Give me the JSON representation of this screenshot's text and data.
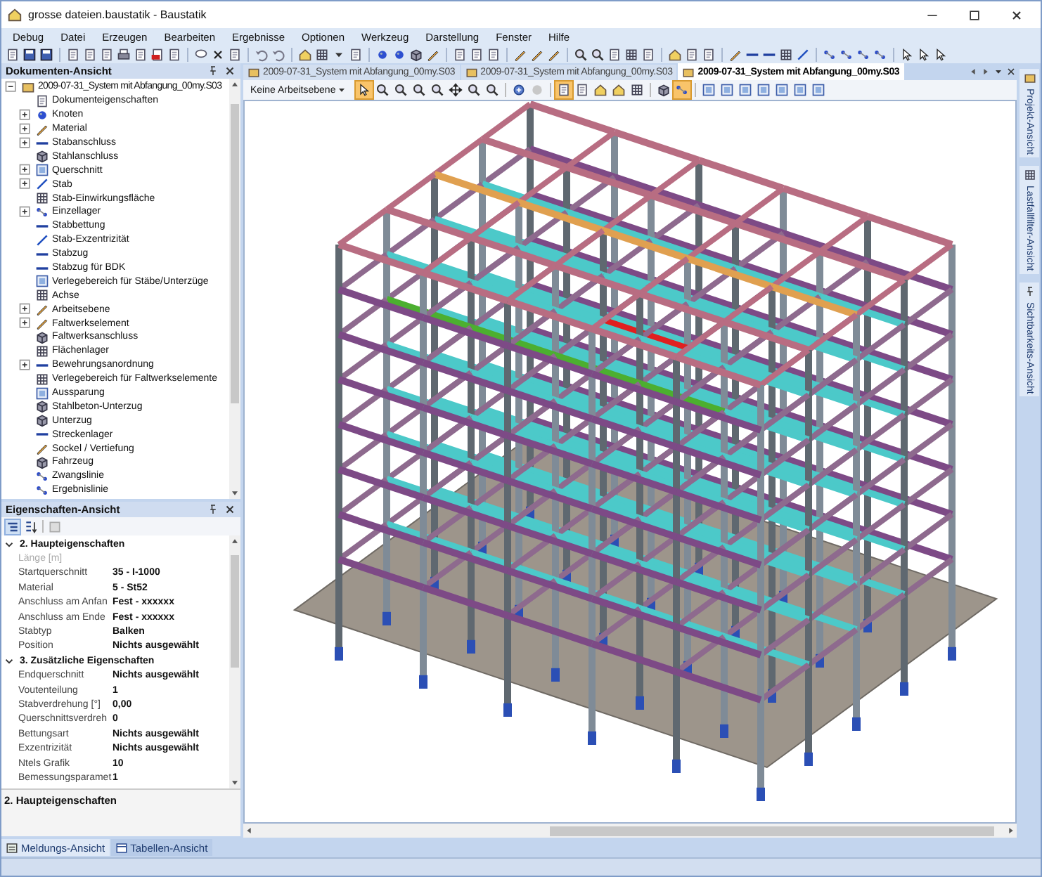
{
  "window": {
    "title": "grosse dateien.baustatik - Baustatik"
  },
  "menu": [
    "Debug",
    "Datei",
    "Erzeugen",
    "Bearbeiten",
    "Ergebnisse",
    "Optionen",
    "Werkzeug",
    "Darstellung",
    "Fenster",
    "Hilfe"
  ],
  "documents_panel": {
    "title": "Dokumenten-Ansicht",
    "tree": [
      {
        "label": "2009-07-31_System mit Abfangung_00my.S03",
        "kind": "folder",
        "expanded": true,
        "children": [
          {
            "label": "Dokumenteigenschaften",
            "kind": "leaf"
          },
          {
            "label": "Knoten",
            "kind": "folder",
            "expanded": false
          },
          {
            "label": "Material",
            "kind": "folder",
            "expanded": false
          },
          {
            "label": "Stabanschluss",
            "kind": "folder",
            "expanded": false
          },
          {
            "label": "Stahlanschluss",
            "kind": "leaf"
          },
          {
            "label": "Querschnitt",
            "kind": "folder",
            "expanded": false
          },
          {
            "label": "Stab",
            "kind": "folder",
            "expanded": false
          },
          {
            "label": "Stab-Einwirkungsfläche",
            "kind": "leaf"
          },
          {
            "label": "Einzellager",
            "kind": "folder",
            "expanded": false
          },
          {
            "label": "Stabbettung",
            "kind": "leaf"
          },
          {
            "label": "Stab-Exzentrizität",
            "kind": "leaf"
          },
          {
            "label": "Stabzug",
            "kind": "leaf"
          },
          {
            "label": "Stabzug für BDK",
            "kind": "leaf"
          },
          {
            "label": "Verlegebereich für Stäbe/Unterzüge",
            "kind": "leaf"
          },
          {
            "label": "Achse",
            "kind": "leaf"
          },
          {
            "label": "Arbeitsebene",
            "kind": "folder",
            "expanded": false
          },
          {
            "label": "Faltwerkselement",
            "kind": "folder",
            "expanded": false
          },
          {
            "label": "Faltwerksanschluss",
            "kind": "leaf"
          },
          {
            "label": "Flächenlager",
            "kind": "leaf"
          },
          {
            "label": "Bewehrungsanordnung",
            "kind": "folder",
            "expanded": false
          },
          {
            "label": "Verlegebereich für Faltwerkselemente",
            "kind": "leaf"
          },
          {
            "label": "Aussparung",
            "kind": "leaf"
          },
          {
            "label": "Stahlbeton-Unterzug",
            "kind": "leaf"
          },
          {
            "label": "Unterzug",
            "kind": "leaf"
          },
          {
            "label": "Streckenlager",
            "kind": "leaf"
          },
          {
            "label": "Sockel / Vertiefung",
            "kind": "leaf"
          },
          {
            "label": "Fahrzeug",
            "kind": "leaf"
          },
          {
            "label": "Zwangslinie",
            "kind": "leaf"
          },
          {
            "label": "Ergebnislinie",
            "kind": "leaf"
          }
        ]
      }
    ]
  },
  "properties_panel": {
    "title": "Eigenschaften-Ansicht",
    "categories": [
      {
        "label": "2. Haupteigenschaften",
        "expanded": true,
        "rows": [
          {
            "name": "Länge [m]",
            "disabled": true
          },
          {
            "name": "Startquerschnitt",
            "value": "35 - I-1000",
            "disabled": false
          },
          {
            "name": "Material",
            "value": "5 - St52",
            "disabled": false
          },
          {
            "name": "Anschluss am Anfan",
            "value": "Fest - xxxxxx",
            "disabled": false
          },
          {
            "name": "Anschluss am Ende",
            "value": "Fest - xxxxxx",
            "disabled": false
          },
          {
            "name": "Stabtyp",
            "value": "Balken",
            "disabled": false
          },
          {
            "name": "Position",
            "value": "Nichts ausgewählt",
            "disabled": false
          }
        ]
      },
      {
        "label": "3. Zusätzliche Eigenschaften",
        "expanded": true,
        "rows": [
          {
            "name": "Endquerschnitt",
            "value": "Nichts ausgewählt",
            "disabled": false
          },
          {
            "name": "Voutenteilung",
            "value": "1",
            "disabled": false
          },
          {
            "name": "Stabverdrehung [°]",
            "value": "0,00",
            "disabled": false
          },
          {
            "name": "Querschnittsverdreh",
            "value": "0",
            "disabled": false
          },
          {
            "name": "Bettungsart",
            "value": "Nichts ausgewählt",
            "disabled": false
          },
          {
            "name": "Exzentrizität",
            "value": "Nichts ausgewählt",
            "disabled": false
          },
          {
            "name": "Ntels Grafik",
            "value": "10",
            "disabled": false
          },
          {
            "name": "Bemessungsparamet",
            "value": "1",
            "disabled": false
          }
        ]
      }
    ],
    "description": "2. Haupteigenschaften"
  },
  "bottom_tabs": [
    {
      "label": "Meldungs-Ansicht",
      "selected": true
    },
    {
      "label": "Tabellen-Ansicht",
      "selected": false
    }
  ],
  "doc_tabs": [
    {
      "label": "2009-07-31_System mit Abfangung_00my.S03",
      "selected": false
    },
    {
      "label": "2009-07-31_System mit Abfangung_00my.S03",
      "selected": false
    },
    {
      "label": "2009-07-31_System mit Abfangung_00my.S03",
      "selected": true
    }
  ],
  "view_toolbar": {
    "workplane": "Keine Arbeitsebene",
    "tools": [
      {
        "active": true
      },
      {
        "active": false
      },
      {
        "active": false
      },
      {
        "active": false
      },
      {
        "active": false
      },
      {
        "active": false
      },
      {
        "active": false
      },
      {
        "active": false
      },
      {
        "active": false
      },
      {
        "active": false
      },
      {
        "active": true
      },
      {
        "active": false
      },
      {
        "active": false
      },
      {
        "active": false
      },
      {
        "active": false
      },
      {
        "active": false
      },
      {
        "active": true
      },
      {
        "active": false
      },
      {
        "active": false
      },
      {
        "active": false
      },
      {
        "active": false
      },
      {
        "active": false
      },
      {
        "active": false
      },
      {
        "active": false
      }
    ]
  },
  "side_tabs": [
    "Projekt-Ansicht",
    "Lastfallfilter-Ansicht",
    "Sichtbarkeits-Ansicht"
  ]
}
